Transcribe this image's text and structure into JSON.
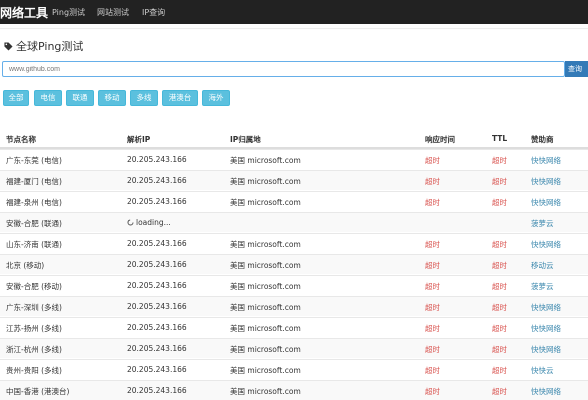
{
  "header": {
    "brand": "网络工具",
    "nav": [
      "Ping测试",
      "网站测试",
      "IP查询"
    ]
  },
  "page": {
    "title": "全球Ping测试"
  },
  "search": {
    "value": "www.github.com",
    "button": "查询"
  },
  "filters": [
    "全部",
    "电信",
    "联通",
    "移动",
    "多线",
    "港澳台",
    "海外"
  ],
  "table": {
    "columns": [
      "节点名称",
      "解析IP",
      "IP归属地",
      "响应时间",
      "TTL",
      "赞助商"
    ],
    "rows": [
      {
        "node": "广东-东莞 (电信)",
        "ip": "20.205.243.166",
        "location": "美国 microsoft.com",
        "time": "超时",
        "ttl": "超时",
        "sponsor": "快快网络"
      },
      {
        "node": "福建-厦门 (电信)",
        "ip": "20.205.243.166",
        "location": "美国 microsoft.com",
        "time": "超时",
        "ttl": "超时",
        "sponsor": "快快网络"
      },
      {
        "node": "福建-泉州 (电信)",
        "ip": "20.205.243.166",
        "location": "美国 microsoft.com",
        "time": "超时",
        "ttl": "超时",
        "sponsor": "快快网络"
      },
      {
        "node": "安徽-合肥 (联通)",
        "ip": "loading...",
        "location": "",
        "time": "",
        "ttl": "",
        "sponsor": "菠萝云"
      },
      {
        "node": "山东-济南 (联通)",
        "ip": "20.205.243.166",
        "location": "美国 microsoft.com",
        "time": "超时",
        "ttl": "超时",
        "sponsor": "快快网络"
      },
      {
        "node": "北京 (移动)",
        "ip": "20.205.243.166",
        "location": "美国 microsoft.com",
        "time": "超时",
        "ttl": "超时",
        "sponsor": "移动云"
      },
      {
        "node": "安徽-合肥 (移动)",
        "ip": "20.205.243.166",
        "location": "美国 microsoft.com",
        "time": "超时",
        "ttl": "超时",
        "sponsor": "菠萝云"
      },
      {
        "node": "广东-深圳 (多线)",
        "ip": "20.205.243.166",
        "location": "美国 microsoft.com",
        "time": "超时",
        "ttl": "超时",
        "sponsor": "快快网络"
      },
      {
        "node": "江苏-扬州 (多线)",
        "ip": "20.205.243.166",
        "location": "美国 microsoft.com",
        "time": "超时",
        "ttl": "超时",
        "sponsor": "快快网络"
      },
      {
        "node": "浙江-杭州 (多线)",
        "ip": "20.205.243.166",
        "location": "美国 microsoft.com",
        "time": "超时",
        "ttl": "超时",
        "sponsor": "快快网络"
      },
      {
        "node": "贵州-贵阳 (多线)",
        "ip": "20.205.243.166",
        "location": "美国 microsoft.com",
        "time": "超时",
        "ttl": "超时",
        "sponsor": "快快云"
      },
      {
        "node": "中国-香港 (港澳台)",
        "ip": "20.205.243.166",
        "location": "美国 microsoft.com",
        "time": "超时",
        "ttl": "超时",
        "sponsor": "快快网络"
      }
    ]
  },
  "icons": {
    "title": "tag-icon",
    "loading": "spinner-icon"
  },
  "colors": {
    "navbar": "#222222",
    "primary": "#337ab7",
    "info": "#5bc0de",
    "timeout": "#d9534f",
    "sponsor": "#3a87ad"
  }
}
